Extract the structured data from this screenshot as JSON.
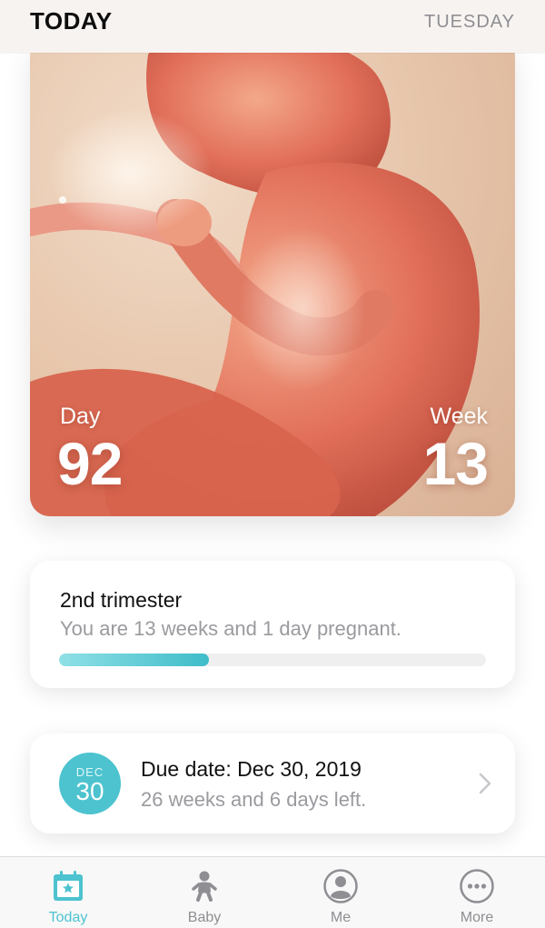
{
  "header": {
    "title": "TODAY",
    "weekday": "TUESDAY"
  },
  "hero": {
    "day_label": "Day",
    "day_value": "92",
    "week_label": "Week",
    "week_value": "13"
  },
  "trimester": {
    "title": "2nd trimester",
    "subtitle": "You are 13 weeks and 1 day pregnant.",
    "progress": 0.35
  },
  "due": {
    "month": "DEC",
    "day": "30",
    "title": "Due date: Dec 30, 2019",
    "subtitle": "26 weeks and 6 days left."
  },
  "tabs": [
    {
      "label": "Today",
      "icon": "calendar-star-icon",
      "active": true
    },
    {
      "label": "Baby",
      "icon": "baby-icon",
      "active": false
    },
    {
      "label": "Me",
      "icon": "person-icon",
      "active": false
    },
    {
      "label": "More",
      "icon": "more-dots-icon",
      "active": false
    }
  ],
  "colors": {
    "accent": "#4cc3cf",
    "inactive": "#8e8e93"
  }
}
